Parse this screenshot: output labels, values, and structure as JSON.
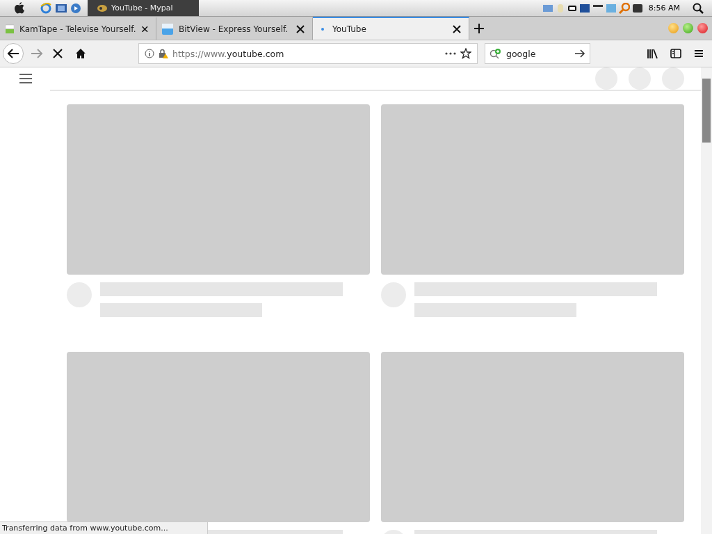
{
  "menubar": {
    "window_title": "YouTube - Mypal",
    "clock": "8:56 AM"
  },
  "tabs": [
    {
      "label": "KamTape - Televise Yourself.",
      "selected": false,
      "loading": false
    },
    {
      "label": "BitView - Express Yourself.",
      "selected": false,
      "loading": false
    },
    {
      "label": "YouTube",
      "selected": true,
      "loading": true
    }
  ],
  "address_bar": {
    "url_prefix": "https://www.",
    "url_domain": "youtube.com"
  },
  "search": {
    "value": "google"
  },
  "status_bar": "Transferring data from www.youtube.com..."
}
